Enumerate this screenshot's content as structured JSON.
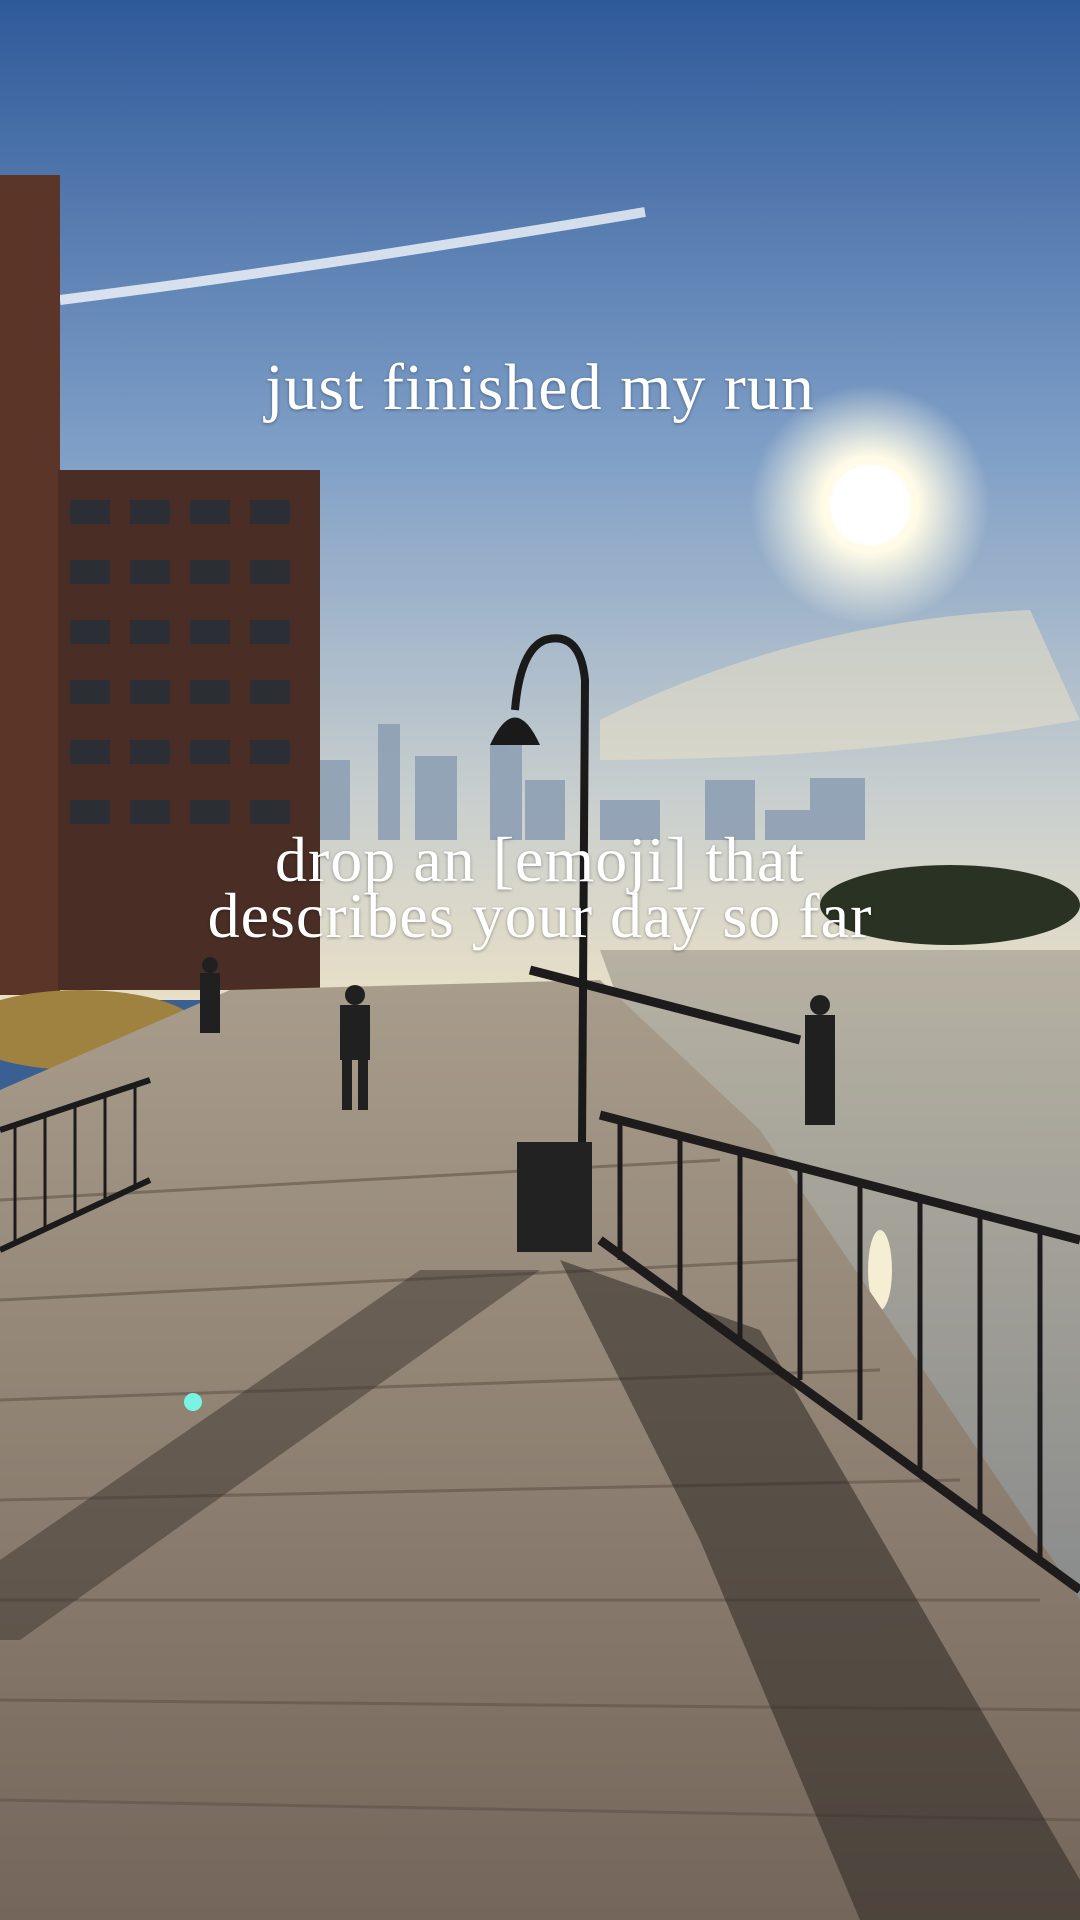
{
  "story": {
    "headline": "just finished my run",
    "prompt_line1": "drop an [emoji] that",
    "prompt_line2": "describes your day so far"
  },
  "colors": {
    "sky_top": "#3b63a3",
    "sky_mid": "#93aed0",
    "horizon": "#d9d7c9",
    "boardwalk": "#8b7e70",
    "railing": "#1e1c1c",
    "building": "#5a3a2c"
  },
  "background": {
    "subject": "riverside-boardwalk-photo"
  }
}
